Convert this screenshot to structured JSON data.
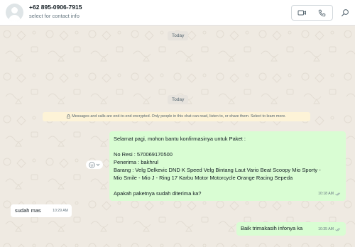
{
  "header": {
    "contact_name": "+62 895-0906-7915",
    "contact_subtitle": "select for contact info"
  },
  "dates": [
    "Today",
    "Today"
  ],
  "encryption_notice": "Messages and calls are end-to-end encrypted. Only people in this chat can read, listen to, or share them. Select to learn more.",
  "messages": [
    {
      "direction": "outgoing",
      "lines": [
        "Selamat pagi, mohon bantu konfirmasinya untuk Paket :",
        "",
        "No Resi : 570069170500",
        "Penerima : bakhrul",
        "Barang : Velg Delkevic DND K Speed Velg Bintang Laut Vario Beat Scoopy Mio Sporty -",
        "Mio Smile - Mio J - Ring 17 Karbu Motor Motorcycle Orange Racing Sepeda",
        "",
        "Apakah paketnya sudah diterima ka?"
      ],
      "time": "10:18 AM"
    },
    {
      "direction": "incoming",
      "text": "sudah mas",
      "time": "10:29 AM"
    },
    {
      "direction": "outgoing",
      "text": "Baik trimakasih infonya ka",
      "time": "10:35 AM"
    }
  ],
  "colors": {
    "outgoing_bubble": "#d9fdd3",
    "incoming_bubble": "#ffffff",
    "chat_background": "#efeae2",
    "read_ticks": "#8696a0"
  }
}
